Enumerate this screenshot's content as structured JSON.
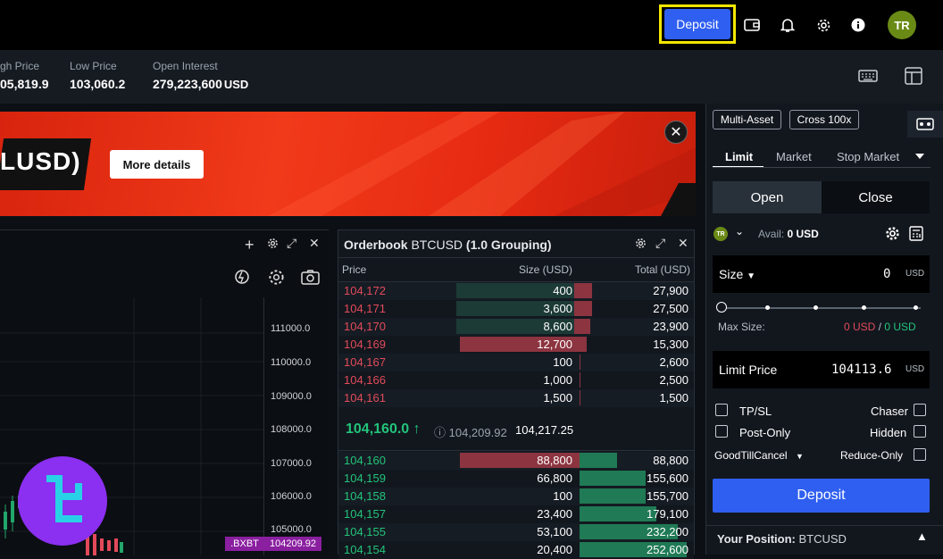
{
  "header": {
    "deposit_label": "Deposit",
    "avatar_initials": "TR"
  },
  "stats": [
    {
      "label": "gh Price",
      "value": "05,819.9"
    },
    {
      "label": "Low Price",
      "value": "103,060.2"
    },
    {
      "label": "Open Interest",
      "value": "279,223,600",
      "unit": "USD"
    }
  ],
  "banner": {
    "title": "LUSD)",
    "button": "More details"
  },
  "chart": {
    "y_ticks": [
      "111000.0",
      "110000.0",
      "109000.0",
      "108000.0",
      "107000.0",
      "106000.0",
      "105000.0"
    ],
    "badge_label": ".BXBT",
    "badge_value": "104209.92"
  },
  "orderbook": {
    "title": "Orderbook",
    "symbol": "BTCUSD",
    "grouping": "(1.0 Grouping)",
    "col_price": "Price",
    "col_size": "Size (USD)",
    "col_total": "Total (USD)",
    "asks": [
      {
        "price": "104,172",
        "size": "400",
        "total": "27,900",
        "size_frac": 0.04,
        "total_frac": 0.11
      },
      {
        "price": "104,171",
        "size": "3,600",
        "total": "27,500",
        "size_frac": 0.04,
        "total_frac": 0.11
      },
      {
        "price": "104,170",
        "size": "8,600",
        "total": "23,900",
        "size_frac": 0.04,
        "total_frac": 0.09
      },
      {
        "price": "104,169",
        "size": "12,700",
        "total": "15,300",
        "size_frac": 0.97,
        "total_frac": 0.06
      },
      {
        "price": "104,167",
        "size": "100",
        "total": "2,600",
        "size_frac": 0.0,
        "total_frac": 0.01
      },
      {
        "price": "104,166",
        "size": "1,000",
        "total": "2,500",
        "size_frac": 0.0,
        "total_frac": 0.01
      },
      {
        "price": "104,161",
        "size": "1,500",
        "total": "1,500",
        "size_frac": 0.0,
        "total_frac": 0.01
      }
    ],
    "mid_price": "104,160.0",
    "mark_price": "104,209.92",
    "index_price": "104,217.25",
    "bids": [
      {
        "price": "104,160",
        "size": "88,800",
        "total": "88,800",
        "size_frac": 0.97,
        "total_frac": 0.33
      },
      {
        "price": "104,159",
        "size": "66,800",
        "total": "155,600",
        "size_frac": 0.0,
        "total_frac": 0.58
      },
      {
        "price": "104,158",
        "size": "100",
        "total": "155,700",
        "size_frac": 0.0,
        "total_frac": 0.58
      },
      {
        "price": "104,157",
        "size": "23,400",
        "total": "179,100",
        "size_frac": 0.0,
        "total_frac": 0.67
      },
      {
        "price": "104,155",
        "size": "53,100",
        "total": "232,200",
        "size_frac": 0.0,
        "total_frac": 0.86
      },
      {
        "price": "104,154",
        "size": "20,400",
        "total": "252,600",
        "size_frac": 0.0,
        "total_frac": 0.94
      }
    ]
  },
  "order_panel": {
    "multi_asset": "Multi-Asset",
    "cross": "Cross 100x",
    "tabs": [
      "Limit",
      "Market",
      "Stop Market"
    ],
    "open": "Open",
    "close": "Close",
    "avail_label": "Avail:",
    "avail_value": "0 USD",
    "size_label": "Size",
    "size_value": "0",
    "size_unit": "USD",
    "max_size_label": "Max Size:",
    "max_size_sell": "0 USD",
    "max_size_buy": "0 USD",
    "slider_fraction": 0,
    "limit_price_label": "Limit Price",
    "limit_price_value": "104113.6",
    "limit_price_unit": "USD",
    "tpsl": "TP/SL",
    "chaser": "Chaser",
    "post_only": "Post-Only",
    "hidden": "Hidden",
    "tif": "GoodTillCancel",
    "reduce_only": "Reduce-Only",
    "deposit_button": "Deposit",
    "position_label": "Your Position:",
    "position_symbol": "BTCUSD"
  }
}
